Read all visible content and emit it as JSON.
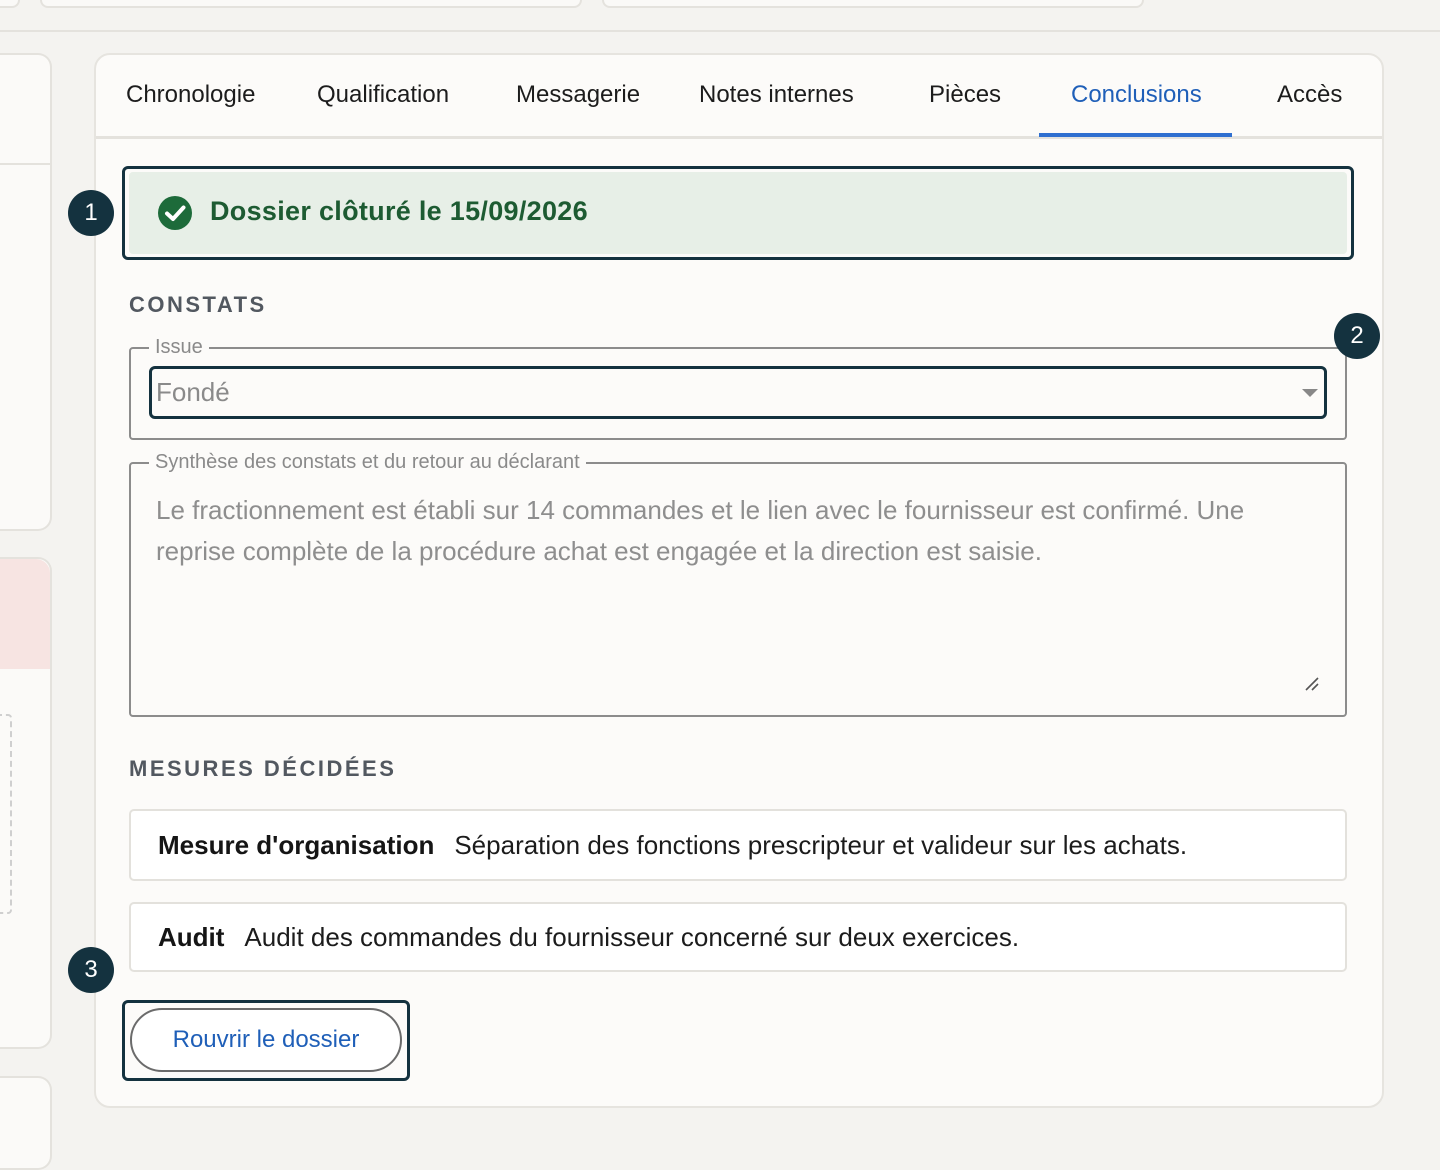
{
  "tabs": [
    {
      "label": "Chronologie"
    },
    {
      "label": "Qualification"
    },
    {
      "label": "Messagerie"
    },
    {
      "label": "Notes internes"
    },
    {
      "label": "Pièces"
    },
    {
      "label": "Conclusions",
      "active": true
    },
    {
      "label": "Accès"
    }
  ],
  "banner": {
    "text": "Dossier clôturé le 15/09/2026",
    "icon": "check-circle-icon",
    "color": "#1d5b32"
  },
  "constats": {
    "title": "CONSTATS",
    "issue_label": "Issue",
    "issue_value": "Fondé",
    "synthese_label": "Synthèse des constats et du retour au déclarant",
    "synthese_value": "Le fractionnement est établi sur 14 commandes et le lien avec le fournisseur est confirmé. Une reprise complète de la procédure achat est engagée et la direction est saisie."
  },
  "mesures": {
    "title": "MESURES DÉCIDÉES",
    "items": [
      {
        "type": "Mesure d'organisation",
        "description": "Séparation des fonctions prescripteur et valideur sur les achats."
      },
      {
        "type": "Audit",
        "description": "Audit des commandes du fournisseur concerné sur deux exercices."
      }
    ]
  },
  "reopen_label": "Rouvrir le dossier",
  "badges": [
    "1",
    "2",
    "3"
  ],
  "colors": {
    "accent": "#1f5fb8",
    "highlight": "#14323f",
    "banner_bg": "#e7efe7"
  }
}
